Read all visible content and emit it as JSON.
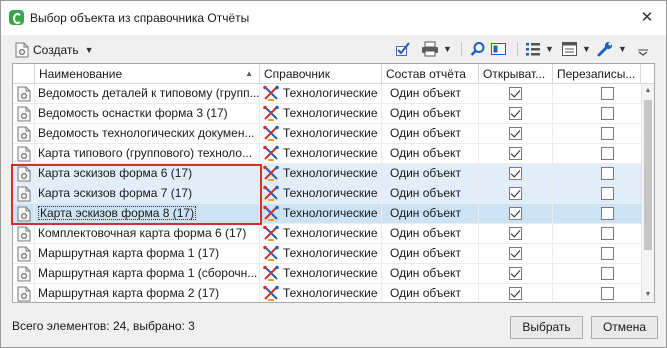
{
  "window": {
    "title": "Выбор объекта из справочника Отчёты"
  },
  "toolbar": {
    "create_label": "Создать",
    "buttons": [
      "check-all-icon",
      "printer-icon",
      "search-icon",
      "panel-icon",
      "list-icon",
      "columns-icon",
      "wrench-icon"
    ]
  },
  "grid": {
    "headers": {
      "name": "Наименование",
      "reference": "Справочник",
      "composition": "Состав отчёта",
      "open": "Открыват...",
      "rewrite": "Перезаписы..."
    },
    "rows": [
      {
        "name": "Ведомость деталей к типовому (групп...",
        "reference": "Технологические",
        "composition": "Один объект",
        "open": true,
        "rewrite": false,
        "state": "normal"
      },
      {
        "name": "Ведомость оснастки форма 3 (17)",
        "reference": "Технологические",
        "composition": "Один объект",
        "open": true,
        "rewrite": false,
        "state": "normal"
      },
      {
        "name": "Ведомость технологических докумен...",
        "reference": "Технологические",
        "composition": "Один объект",
        "open": true,
        "rewrite": false,
        "state": "normal"
      },
      {
        "name": "Карта типового (группового) техноло...",
        "reference": "Технологические",
        "composition": "Один объект",
        "open": true,
        "rewrite": false,
        "state": "normal"
      },
      {
        "name": "Карта эскизов форма 6 (17)",
        "reference": "Технологические",
        "composition": "Один объект",
        "open": true,
        "rewrite": false,
        "state": "selected"
      },
      {
        "name": "Карта эскизов форма 7 (17)",
        "reference": "Технологические",
        "composition": "Один объект",
        "open": true,
        "rewrite": false,
        "state": "selected"
      },
      {
        "name": "Карта эскизов форма 8 (17)",
        "reference": "Технологические",
        "composition": "Один объект",
        "open": true,
        "rewrite": false,
        "state": "focused"
      },
      {
        "name": "Комплектовочная карта форма 6 (17)",
        "reference": "Технологические",
        "composition": "Один объект",
        "open": true,
        "rewrite": false,
        "state": "normal"
      },
      {
        "name": "Маршрутная карта форма 1 (17)",
        "reference": "Технологические",
        "composition": "Один объект",
        "open": true,
        "rewrite": false,
        "state": "normal"
      },
      {
        "name": "Маршрутная карта форма 1 (сборочн...",
        "reference": "Технологические",
        "composition": "Один объект",
        "open": true,
        "rewrite": false,
        "state": "normal"
      },
      {
        "name": "Маршрутная карта форма 2 (17)",
        "reference": "Технологические",
        "composition": "Один объект",
        "open": true,
        "rewrite": false,
        "state": "normal"
      }
    ]
  },
  "footer": {
    "status": "Всего элементов: 24, выбрано: 3",
    "select_label": "Выбрать",
    "cancel_label": "Отмена"
  },
  "colors": {
    "highlight_frame": "#d32f2f",
    "selected_row": "#e1edf8",
    "focused_row": "#cce3f6",
    "app_icon": "#3aa64a"
  }
}
